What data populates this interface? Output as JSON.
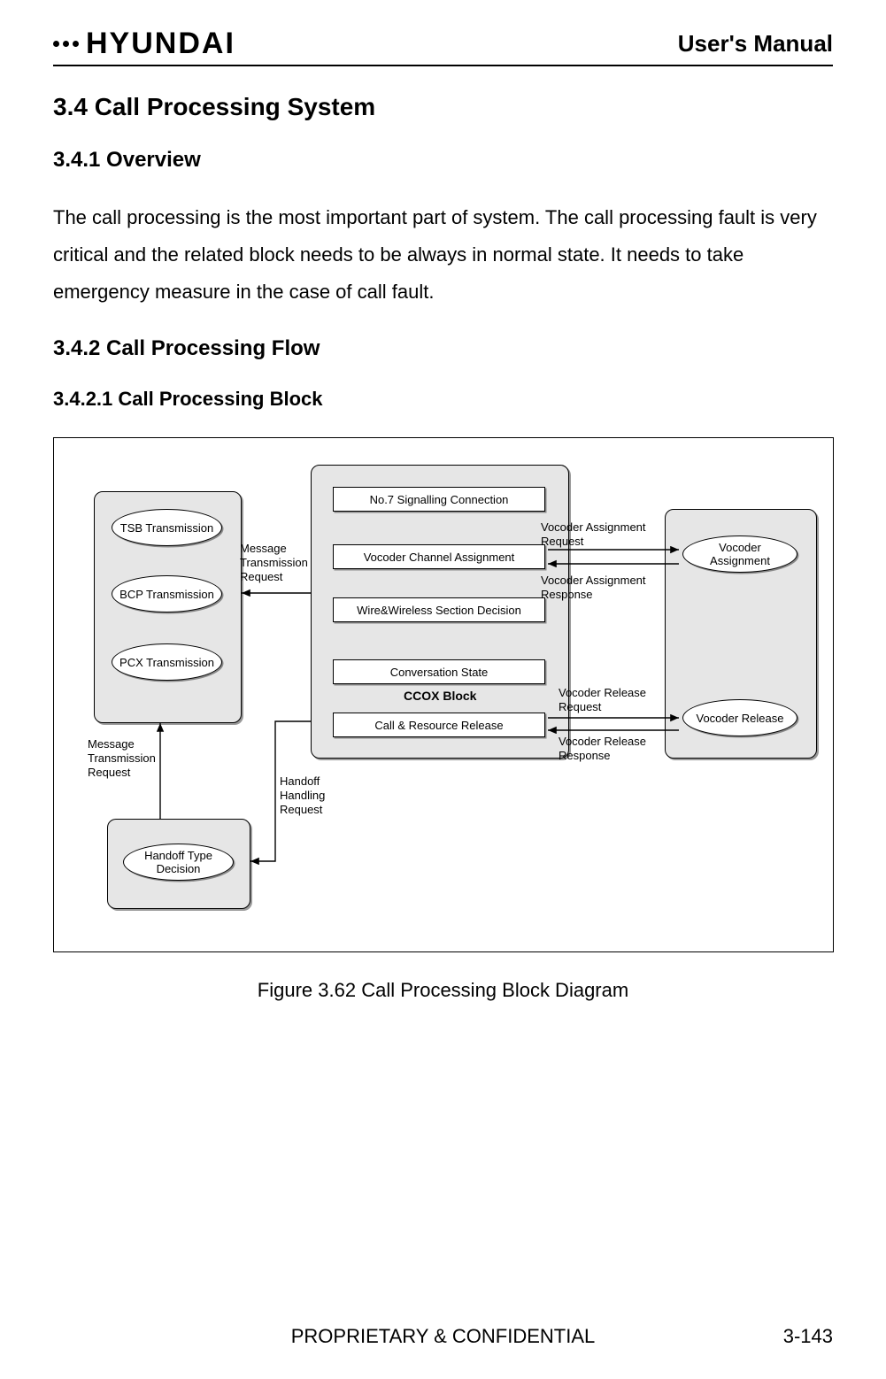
{
  "header": {
    "brand": "HYUNDAI",
    "manual_title": "User's Manual"
  },
  "sections": {
    "s34": "3.4  Call Processing System",
    "s341": "3.4.1  Overview",
    "overview_body": "The call processing is the most important part of system. The call processing fault is very critical and the related block needs to be always in normal state. It needs to take emergency measure in the case of call fault.",
    "s342": "3.4.2  Call Processing Flow",
    "s3421": "3.4.2.1  Call Processing Block",
    "figure_caption": "Figure 3.62 Call Processing Block Diagram"
  },
  "diagram": {
    "left_block": {
      "items": [
        "TSB Transmission",
        "BCP Transmission",
        "PCX Transmission"
      ]
    },
    "handoff_block": {
      "item": "Handoff Type Decision"
    },
    "ccox_block": {
      "title": "CCOX Block",
      "items": [
        "No.7 Signalling Connection",
        "Vocoder Channel Assignment",
        "Wire&Wireless Section Decision",
        "Conversation State",
        "Call & Resource Release"
      ]
    },
    "right_block": {
      "items": [
        "Vocoder Assignment",
        "Vocoder Release"
      ]
    },
    "labels": {
      "msg_trans_req_top": "Message Transmission Request",
      "msg_trans_req_left": "Message Transmission Request",
      "handoff_handling_req": "Handoff Handling Request",
      "voc_assign_req": "Vocoder Assignment Request",
      "voc_assign_resp": "Vocoder Assignment Response",
      "voc_release_req": "Vocoder Release Request",
      "voc_release_resp": "Vocoder Release Response"
    }
  },
  "footer": {
    "confidential": "PROPRIETARY & CONFIDENTIAL",
    "page": "3-143"
  }
}
